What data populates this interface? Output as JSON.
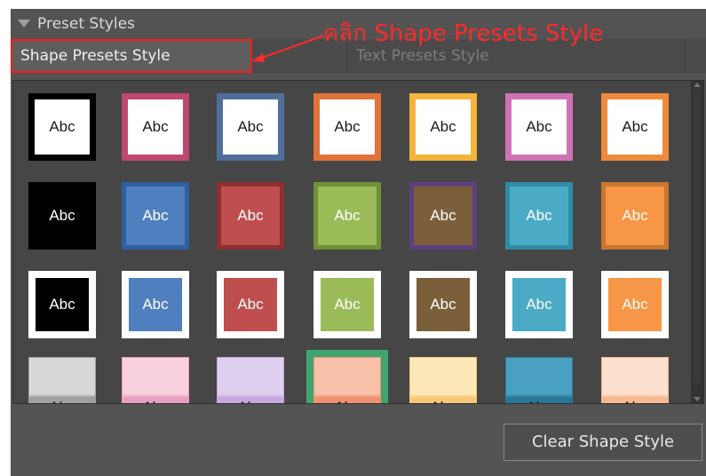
{
  "panel": {
    "title": "Preset Styles",
    "tabs": [
      {
        "label": "Shape Presets Style",
        "active": true
      },
      {
        "label": "Text Presets Style",
        "active": false
      }
    ],
    "annotation": "คลิก Shape Presets Style",
    "clear_button": "Clear Shape Style"
  },
  "tile_label": "Abc",
  "colors": {
    "row1_borders": [
      "#000000",
      "#c0476f",
      "#4f6f9a",
      "#e0723a",
      "#f4b43a",
      "#cf72b4",
      "#ef8a3a"
    ],
    "row2_fills": [
      "#000000",
      "#4f7fbf",
      "#bf4f4f",
      "#9bbb59",
      "#7a5f3a",
      "#4babc6",
      "#f79646"
    ],
    "row2_borders": [
      "#000000",
      "#2e5f9f",
      "#8f2f2f",
      "#6f8f39",
      "#5f3f7f",
      "#2f8ba6",
      "#c7762f"
    ],
    "row3_fills": [
      "#000000",
      "#4f7fbf",
      "#bf4f4f",
      "#9bbb59",
      "#7a5f3a",
      "#4babc6",
      "#f79646"
    ],
    "row4_gradients": [
      [
        "#d8d8d8",
        "#a0a0a0"
      ],
      [
        "#f8d0e0",
        "#e8a0c0"
      ],
      [
        "#e0d0f0",
        "#c8a8e0"
      ],
      [
        "#f8c0a8",
        "#f09070"
      ],
      [
        "#fde8b8",
        "#f8c878"
      ],
      [
        "#4aa0c0",
        "#2a7898"
      ],
      [
        "#fde0d0",
        "#f8b890"
      ]
    ],
    "selection": "#3fa56f",
    "annotation": "#ff2a2a"
  }
}
